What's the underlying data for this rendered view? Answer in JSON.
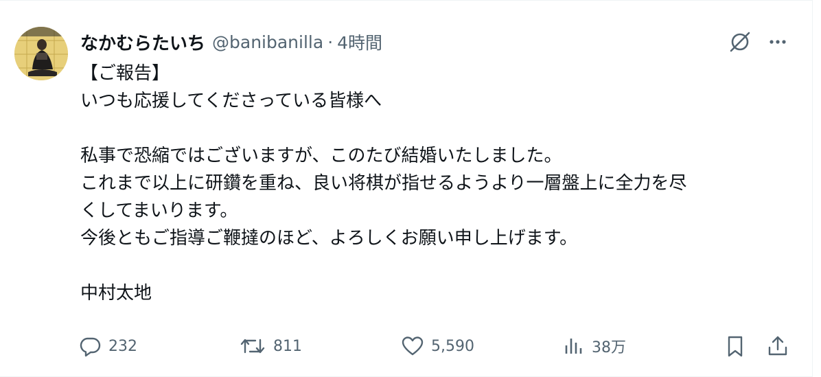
{
  "author": {
    "display_name": "なかむらたいち",
    "handle": "@banibanilla",
    "separator": "·",
    "time": "4時間"
  },
  "body": {
    "lines": [
      "【ご報告】",
      "いつも応援してくださっている皆様へ",
      "",
      "私事で恐縮ではございますが、このたび結婚いたしました。",
      "これまで以上に研鑽を重ね、良い将棋が指せるようより一層盤上に全力を尽",
      "くしてまいります。",
      "今後ともご指導ご鞭撻のほど、よろしくお願い申し上げます。",
      "",
      "中村太地"
    ]
  },
  "actions": {
    "reply_count": "232",
    "repost_count": "811",
    "like_count": "5,590",
    "views_count": "38万"
  },
  "icons": {
    "grok": "grok-icon",
    "more": "more-icon",
    "reply": "reply-icon",
    "repost": "repost-icon",
    "like": "heart-icon",
    "views": "views-icon",
    "bookmark": "bookmark-icon",
    "share": "share-icon"
  },
  "colors": {
    "text": "#0f1419",
    "secondary": "#536471",
    "border": "#eff3f4"
  }
}
